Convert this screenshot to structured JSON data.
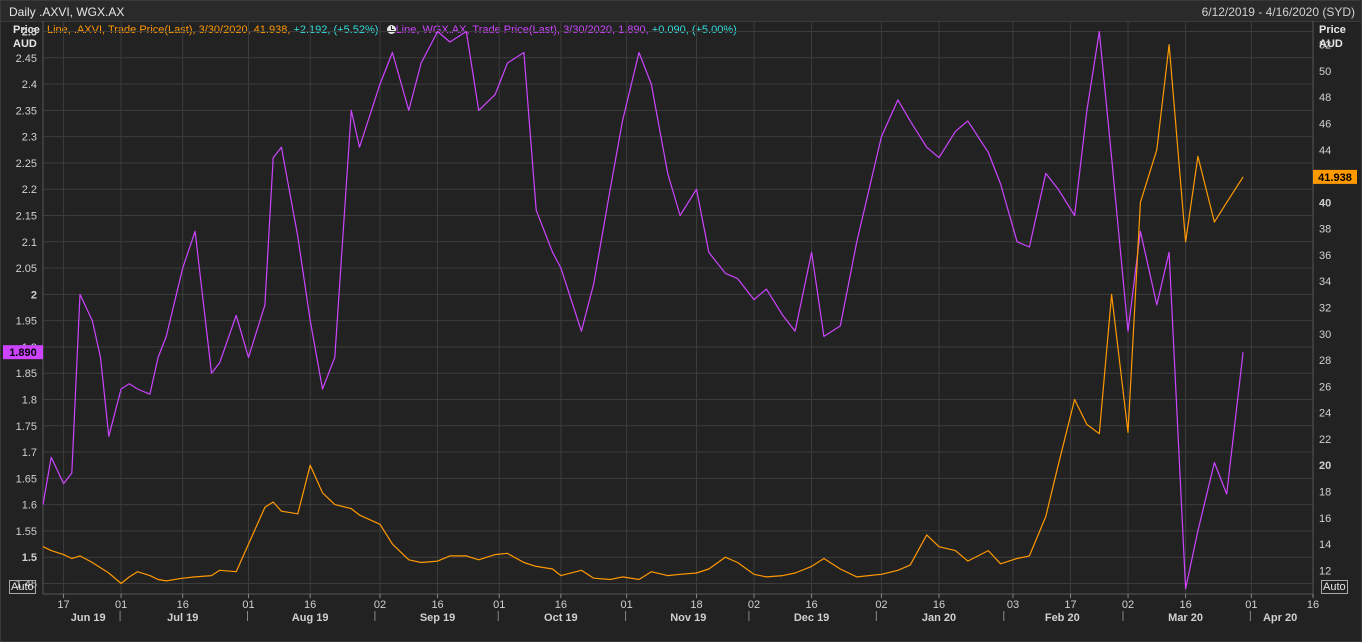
{
  "header": {
    "title": "Daily .AXVI, WGX.AX",
    "date_range": "6/12/2019 - 4/16/2020 (SYD)"
  },
  "left_axis": {
    "title_line1": "Price",
    "title_line2": "AUD"
  },
  "right_axis": {
    "title_line1": "Price",
    "title_line2": "AUD"
  },
  "legend": {
    "axvi": {
      "text": "Line, .AXVI, Trade Price(Last), 3/30/2020, 41.938, ",
      "change": "+2.192, (+5.52%),",
      "color": "#ff9900"
    },
    "wgx": {
      "text": "Line, WGX.AX, Trade Price(Last), 3/30/2020, 1.890, ",
      "change": "+0.090, (+5.00%)",
      "color": "#cc44ff"
    },
    "change_color": "#33dddd",
    "clock_icon": "clock-icon"
  },
  "auto_left": "Auto",
  "auto_right": "Auto",
  "colors": {
    "axvi": "#ff9900",
    "wgx": "#cc44ff",
    "grid": "#3c3c3c",
    "background": "#222222"
  },
  "chart_data": {
    "type": "line",
    "grid": true,
    "legend_position": "top-left",
    "x_tick_labels": [
      "17",
      "01",
      "16",
      "01",
      "16",
      "02",
      "16",
      "01",
      "16",
      "01",
      "18",
      "02",
      "16",
      "02",
      "16",
      "03",
      "17",
      "02",
      "16",
      "01",
      "16"
    ],
    "x_month_labels": [
      "Jun 19",
      "Jul 19",
      "Aug 19",
      "Sep 19",
      "Oct 19",
      "Nov 19",
      "Dec 19",
      "Jan 20",
      "Feb 20",
      "Mar 20",
      "Apr 20"
    ],
    "y_left": {
      "range": [
        1.43,
        2.52
      ],
      "ticks": [
        "1.45",
        "1.5",
        "1.55",
        "1.6",
        "1.65",
        "1.7",
        "1.75",
        "1.8",
        "1.85",
        "1.9",
        "1.95",
        "2",
        "2.05",
        "2.1",
        "2.15",
        "2.2",
        "2.25",
        "2.3",
        "2.35",
        "2.4",
        "2.45",
        "2.5"
      ],
      "last_value_label": "1.890"
    },
    "y_right": {
      "range": [
        10.2,
        53.8
      ],
      "ticks": [
        "12",
        "14",
        "16",
        "18",
        "20",
        "22",
        "24",
        "26",
        "28",
        "30",
        "32",
        "34",
        "36",
        "38",
        "40",
        "42",
        "44",
        "46",
        "48",
        "50",
        "52"
      ],
      "last_value_label": "41.938"
    },
    "series": [
      {
        "name": "WGX.AX",
        "axis": "left",
        "color": "#cc44ff",
        "x": [
          "2019-06-12",
          "2019-06-14",
          "2019-06-17",
          "2019-06-19",
          "2019-06-21",
          "2019-06-24",
          "2019-06-26",
          "2019-06-28",
          "2019-07-01",
          "2019-07-03",
          "2019-07-05",
          "2019-07-08",
          "2019-07-10",
          "2019-07-12",
          "2019-07-16",
          "2019-07-19",
          "2019-07-23",
          "2019-07-25",
          "2019-07-29",
          "2019-08-01",
          "2019-08-05",
          "2019-08-07",
          "2019-08-09",
          "2019-08-13",
          "2019-08-16",
          "2019-08-19",
          "2019-08-22",
          "2019-08-26",
          "2019-08-28",
          "2019-09-02",
          "2019-09-05",
          "2019-09-09",
          "2019-09-12",
          "2019-09-16",
          "2019-09-19",
          "2019-09-23",
          "2019-09-26",
          "2019-09-30",
          "2019-10-03",
          "2019-10-07",
          "2019-10-10",
          "2019-10-14",
          "2019-10-16",
          "2019-10-21",
          "2019-10-24",
          "2019-10-28",
          "2019-10-31",
          "2019-11-04",
          "2019-11-07",
          "2019-11-11",
          "2019-11-14",
          "2019-11-18",
          "2019-11-21",
          "2019-11-25",
          "2019-11-28",
          "2019-12-02",
          "2019-12-05",
          "2019-12-09",
          "2019-12-12",
          "2019-12-16",
          "2019-12-19",
          "2019-12-23",
          "2019-12-27",
          "2020-01-02",
          "2020-01-06",
          "2020-01-09",
          "2020-01-13",
          "2020-01-16",
          "2020-01-20",
          "2020-01-23",
          "2020-01-28",
          "2020-01-31",
          "2020-02-04",
          "2020-02-07",
          "2020-02-11",
          "2020-02-14",
          "2020-02-18",
          "2020-02-21",
          "2020-02-24",
          "2020-02-27",
          "2020-03-02",
          "2020-03-05",
          "2020-03-09",
          "2020-03-12",
          "2020-03-16",
          "2020-03-19",
          "2020-03-23",
          "2020-03-26",
          "2020-03-30"
        ],
        "values": [
          1.6,
          1.69,
          1.64,
          1.66,
          2.0,
          1.95,
          1.88,
          1.73,
          1.82,
          1.83,
          1.82,
          1.81,
          1.88,
          1.92,
          2.05,
          2.12,
          1.85,
          1.87,
          1.96,
          1.88,
          1.98,
          2.26,
          2.28,
          2.11,
          1.95,
          1.82,
          1.88,
          2.35,
          2.28,
          2.4,
          2.46,
          2.35,
          2.44,
          2.5,
          2.48,
          2.5,
          2.35,
          2.38,
          2.44,
          2.46,
          2.16,
          2.08,
          2.05,
          1.93,
          2.02,
          2.2,
          2.33,
          2.46,
          2.4,
          2.23,
          2.15,
          2.2,
          2.08,
          2.04,
          2.03,
          1.99,
          2.01,
          1.96,
          1.93,
          2.08,
          1.92,
          1.94,
          2.1,
          2.3,
          2.37,
          2.33,
          2.28,
          2.26,
          2.31,
          2.33,
          2.27,
          2.21,
          2.1,
          2.09,
          2.23,
          2.2,
          2.15,
          2.35,
          2.5,
          2.26,
          1.93,
          2.12,
          1.98,
          2.08,
          1.44,
          1.55,
          1.68,
          1.62,
          1.89
        ]
      },
      {
        "name": ".AXVI",
        "axis": "right",
        "color": "#ff9900",
        "x": [
          "2019-06-12",
          "2019-06-14",
          "2019-06-17",
          "2019-06-19",
          "2019-06-21",
          "2019-06-24",
          "2019-06-26",
          "2019-06-28",
          "2019-07-01",
          "2019-07-03",
          "2019-07-05",
          "2019-07-08",
          "2019-07-10",
          "2019-07-12",
          "2019-07-16",
          "2019-07-19",
          "2019-07-23",
          "2019-07-25",
          "2019-07-29",
          "2019-08-01",
          "2019-08-05",
          "2019-08-07",
          "2019-08-09",
          "2019-08-13",
          "2019-08-16",
          "2019-08-19",
          "2019-08-22",
          "2019-08-26",
          "2019-08-28",
          "2019-09-02",
          "2019-09-05",
          "2019-09-09",
          "2019-09-12",
          "2019-09-16",
          "2019-09-19",
          "2019-09-23",
          "2019-09-26",
          "2019-09-30",
          "2019-10-03",
          "2019-10-07",
          "2019-10-10",
          "2019-10-14",
          "2019-10-16",
          "2019-10-21",
          "2019-10-24",
          "2019-10-28",
          "2019-10-31",
          "2019-11-04",
          "2019-11-07",
          "2019-11-11",
          "2019-11-14",
          "2019-11-18",
          "2019-11-21",
          "2019-11-25",
          "2019-11-28",
          "2019-12-02",
          "2019-12-05",
          "2019-12-09",
          "2019-12-12",
          "2019-12-16",
          "2019-12-19",
          "2019-12-23",
          "2019-12-27",
          "2020-01-02",
          "2020-01-06",
          "2020-01-09",
          "2020-01-13",
          "2020-01-16",
          "2020-01-20",
          "2020-01-23",
          "2020-01-28",
          "2020-01-31",
          "2020-02-04",
          "2020-02-07",
          "2020-02-11",
          "2020-02-14",
          "2020-02-18",
          "2020-02-21",
          "2020-02-24",
          "2020-02-27",
          "2020-03-02",
          "2020-03-05",
          "2020-03-09",
          "2020-03-12",
          "2020-03-16",
          "2020-03-19",
          "2020-03-23",
          "2020-03-26",
          "2020-03-30"
        ],
        "values": [
          13.8,
          13.5,
          13.2,
          12.9,
          13.1,
          12.6,
          12.2,
          11.8,
          11.0,
          11.5,
          11.9,
          11.6,
          11.3,
          11.2,
          11.4,
          11.5,
          11.6,
          12.0,
          11.9,
          14.0,
          16.8,
          17.2,
          16.5,
          16.3,
          20.0,
          17.9,
          17.0,
          16.7,
          16.2,
          15.5,
          14.0,
          12.8,
          12.6,
          12.7,
          13.1,
          13.1,
          12.8,
          13.2,
          13.3,
          12.6,
          12.3,
          12.1,
          11.6,
          12.0,
          11.4,
          11.3,
          11.5,
          11.3,
          11.9,
          11.6,
          11.7,
          11.8,
          12.1,
          13.0,
          12.6,
          11.7,
          11.5,
          11.6,
          11.8,
          12.3,
          12.9,
          12.1,
          11.5,
          11.7,
          12.0,
          12.4,
          14.7,
          13.8,
          13.5,
          12.7,
          13.5,
          12.5,
          12.9,
          13.1,
          16.1,
          20.0,
          25.0,
          23.1,
          22.4,
          33.0,
          22.5,
          40.0,
          44.0,
          52.0,
          37.0,
          43.5,
          38.5,
          40.0,
          41.938
        ]
      }
    ]
  }
}
